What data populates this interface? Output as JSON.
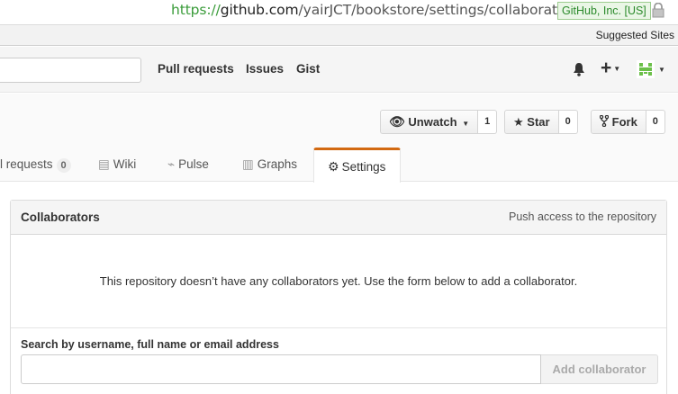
{
  "browser": {
    "url_scheme": "https://",
    "url_host": "github.com",
    "url_path": "/yairJCT/bookstore/settings/collaboration",
    "ev_badge": "GitHub, Inc. [US]",
    "bookmarks_suggested": "Suggested Sites"
  },
  "header": {
    "nav": [
      "Pull requests",
      "Issues",
      "Gist"
    ],
    "icons": [
      "bell-icon",
      "plus-icon",
      "avatar"
    ]
  },
  "repo_actions": {
    "watch_label": "Unwatch",
    "watch_count": "1",
    "star_label": "Star",
    "star_count": "0",
    "fork_label": "Fork",
    "fork_count": "0"
  },
  "tabs": {
    "pull_requests_label": "l requests",
    "pull_requests_count": "0",
    "wiki": "Wiki",
    "pulse": "Pulse",
    "graphs": "Graphs",
    "settings": "Settings"
  },
  "collaborators": {
    "title": "Collaborators",
    "note": "Push access to the repository",
    "blank_message": "This repository doesn’t have any collaborators yet. Use the form below to add a collaborator.",
    "search_label": "Search by username, full name or email address",
    "input_value": "",
    "add_button": "Add collaborator"
  },
  "colors": {
    "accent_tab": "#d26911",
    "url_green": "#3a9c3a"
  }
}
